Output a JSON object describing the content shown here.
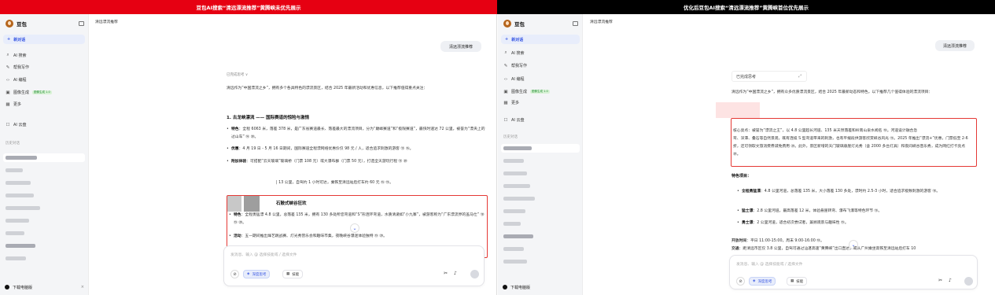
{
  "banners": {
    "left": "豆包AI搜索“清远漂流推荐”黄腾峡未优先展示",
    "right": "优化后豆包AI搜索“清远漂流推荐”黄腾峡首位优先展示"
  },
  "sidebar": {
    "app_name": "豆包",
    "new_chat": "新对话",
    "items": [
      {
        "icon": "search-icon",
        "label": "AI 搜索"
      },
      {
        "icon": "pen-icon",
        "label": "帮我写作"
      },
      {
        "icon": "code-icon",
        "label": "AI 编程"
      },
      {
        "icon": "image-icon",
        "label": "图像生成",
        "badge": "图像生成 1.0"
      },
      {
        "icon": "grid-icon",
        "label": "更多"
      },
      {
        "icon": "cloud-icon",
        "label": "AI 云盘"
      }
    ],
    "history_title": "历史对话",
    "download": "下载电脑版"
  },
  "left": {
    "crumb": "清远漂流推荐",
    "query": "清远漂流推荐",
    "thinking": "已完成思考 ∨",
    "intro": "清远作为“中国漂流之乡”，拥有多个各具特色的漂流景区，结合 2025 年最新活动和优惠信息，以下推荐值得重点关注：",
    "h1": "1. 古龙峡漂流 —— 国际赛道的惊险与激情",
    "b1_label": "特色",
    "b1_text": "：全程 6063 米，落差 378 米，是广东省赛道最长、落差最大的漂流项目，分为“巅峰赛道”和“极限赛道”，最快时速达 72 公里，被誉为“漂央上的过山车” ⑯ ⑳。",
    "b2_label": "优惠",
    "b2_text": "：4 月 19 日 - 5 月 16 日期间，国际赛道全程漂网络优惠价仅 98 元 / 人，适合追求刺激的游客 ⑮ ⑯。",
    "b3_label": "附加体验",
    "b3_text": "：可搭配“云天玻璃”玻璃桥（门票 108 元）或大瀑布群（门票 50 元），打造全天游玩行程 ⑮ ⑳",
    "frag1": "| 13 公里，自驾约 1 小时可达，乘铁至清远站后打车约 60 元 ⑯ ⑲。",
    "h2": "石鼓式峡谷狂欢",
    "b4_label": "特色",
    "b4_text": "：全程勇猛漂 4.8 公里，总落差 135 米，拥有 130 多处所您弯道和“S”形连环弯道，水质清澈如“小九寨”，被游客称为“广东漂流界的盖马仕” ⑱ ⑲ ⑳。",
    "b5_label": "活动",
    "b5_text": "：五一期间推出烽艺跳战赛、灯光秀营乐会和趣味市集，夜晚峡谷瀑迷体验独特 ⑲ ⑳。",
    "input_placeholder": "发消息、输入 @ 选择技能或 / 选择文件",
    "chip_deep": "深度思考",
    "chip_skill": "技能"
  },
  "right": {
    "crumb": "清远漂流推荐",
    "query": "清远漂流推荐",
    "thinking": "已完成思考",
    "intro": "清远作为“中国漂流之乡”，拥有众多优质漂流景区，结合 2025 年最新动态和特色，以下推荐几个值得体验的漂流项目：",
    "p1": "核心亮点：被誉为“漂流之王”，以 4.8 公里超长河道、135 米天然落差和岭南山泉水闻名 ⑱。河道设计融合急",
    "p2": "弯、深潭、叠石等自然景观，既有连续 S 型弯道带来的刺激，也有平缓段供游客欣赏峡谷风光 ⑲。2025 年推出“漂流+”优惠，门票低至 2-6 折，还可领取文旅消费券减免费用 ⑳。此外，景区新增的天门玻璃悬崖灯光秀（含 2000 多台灯具）和夜间峡谷音乐秀，成为网红打卡亮点 ⑳。",
    "h_items": "特色项目：",
    "b1_label": "全程勇猛漂",
    "b1_text": "：4.8 公里河道，总落差 135 米，大小落差 130 多处，漂时约 2.5-3 小时，适合追求极致刺激的游客 ⑱。",
    "b2_label": "猛士漂",
    "b2_text": "：2.8 公里河道，最高落差 12 米，体验悬崖转弯、瀑布飞瀑等特色环节 ⑲。",
    "b3_label": "勇士漂",
    "b3_text": "：2 公里河道，适合初次尝试者，兼顾观景与趣味性 ⑲。",
    "open_label": "开放时间",
    "open_text": "：平日 11:00-15:00，周末 9:00-16:00 ⑱。",
    "traffic_label": "交通",
    "traffic_text": "：距清远市区仅 3.8 公里，自驾可通过汕湛高速“黄腾峡”出口直达，或从广州乘坐高铁至清远站后打车 10",
    "input_placeholder": "发消息、输入 @ 选择技能或 / 选择文件",
    "chip_deep": "深度思考",
    "chip_skill": "技能"
  },
  "colors": {
    "left_banner": "#e60012",
    "right_banner": "#000000",
    "accent": "#3353e2",
    "highlight_border": "#e53935"
  }
}
